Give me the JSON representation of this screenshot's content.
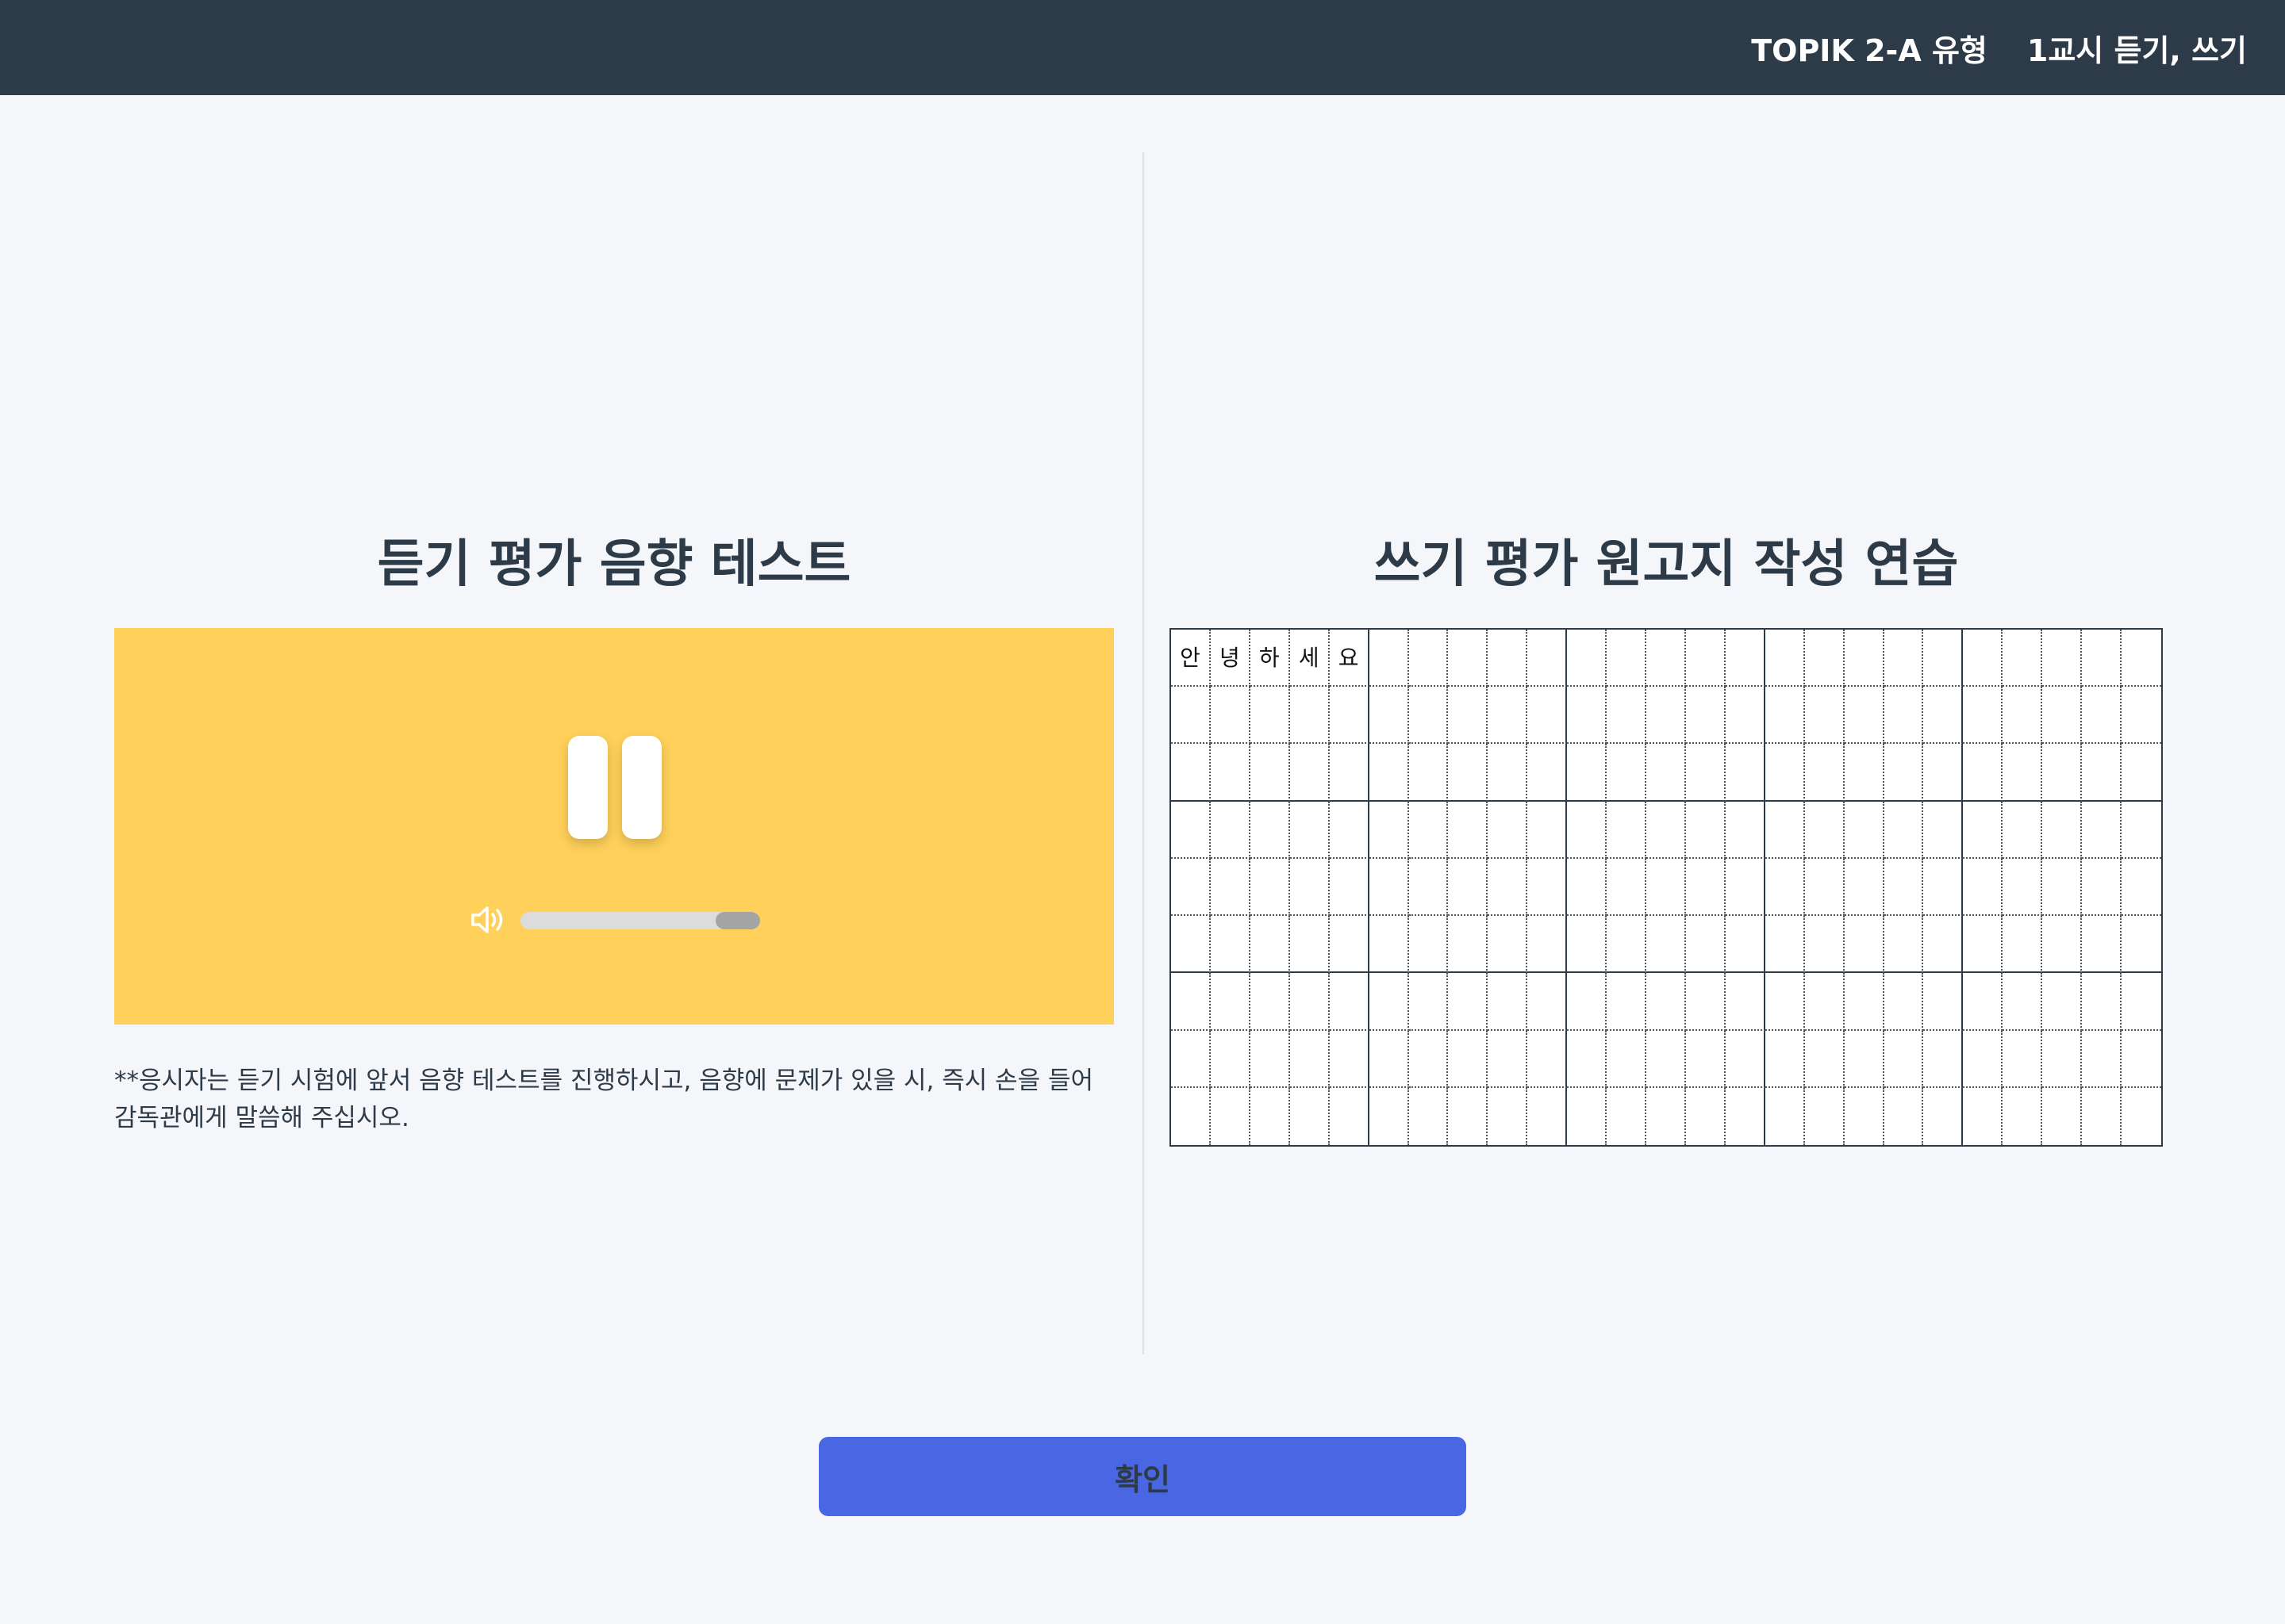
{
  "header": {
    "exam_type": "TOPIK 2-A 유형",
    "session": "1교시 듣기, 쓰기"
  },
  "listening": {
    "title": "듣기 평가 음향 테스트",
    "player": {
      "state_icon": "pause-icon",
      "volume_icon": "speaker-icon",
      "volume_level": 1.0
    },
    "notice": "**응시자는 듣기 시험에 앞서 음향 테스트를 진행하시고, 음향에 문제가 있을 시, 즉시 손을 들어 감독관에게 말씀해 주십시오."
  },
  "writing": {
    "title": "쓰기 평가 원고지 작성 연습",
    "grid_columns": 25,
    "grid_rows": 9,
    "cells_filled": [
      "안",
      "녕",
      "하",
      "세",
      "요"
    ]
  },
  "confirm_label": "확인",
  "colors": {
    "header_bg": "#2d3a48",
    "player_bg": "#ffd05a",
    "button_bg": "#4a67e3",
    "page_bg": "#f5f6fa"
  }
}
